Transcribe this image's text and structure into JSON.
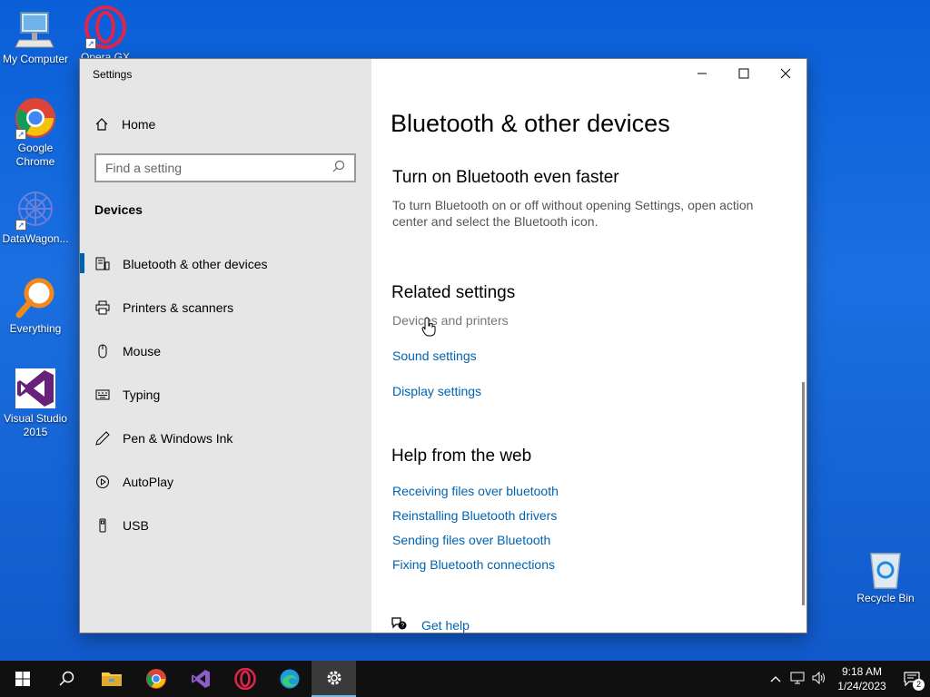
{
  "desktop": {
    "icons": [
      {
        "label": "My Computer"
      },
      {
        "label": "Opera GX"
      },
      {
        "label": "Google Chrome"
      },
      {
        "label": "DataWagon..."
      },
      {
        "label": "Everything"
      },
      {
        "label": "Visual Studio 2015"
      },
      {
        "label": "Recycle Bin"
      }
    ]
  },
  "window": {
    "title": "Settings",
    "sidebar": {
      "home_label": "Home",
      "search_placeholder": "Find a setting",
      "section_label": "Devices",
      "items": [
        {
          "label": "Bluetooth & other devices",
          "icon": "bluetooth-devices-icon",
          "active": true
        },
        {
          "label": "Printers & scanners",
          "icon": "printer-icon"
        },
        {
          "label": "Mouse",
          "icon": "mouse-icon"
        },
        {
          "label": "Typing",
          "icon": "keyboard-icon"
        },
        {
          "label": "Pen & Windows Ink",
          "icon": "pen-icon"
        },
        {
          "label": "AutoPlay",
          "icon": "autoplay-icon"
        },
        {
          "label": "USB",
          "icon": "usb-icon"
        }
      ]
    },
    "content": {
      "page_title": "Bluetooth & other devices",
      "faster_heading": "Turn on Bluetooth even faster",
      "faster_desc": "To turn Bluetooth on or off without opening Settings, open action center and select the Bluetooth icon.",
      "related_heading": "Related settings",
      "related_links": [
        "Devices and printers",
        "Sound settings",
        "Display settings"
      ],
      "help_heading": "Help from the web",
      "help_links": [
        "Receiving files over bluetooth",
        "Reinstalling Bluetooth drivers",
        "Sending files over Bluetooth",
        "Fixing Bluetooth connections"
      ],
      "get_help": "Get help"
    }
  },
  "taskbar": {
    "time": "9:18 AM",
    "date": "1/24/2023",
    "notification_count": "2"
  },
  "colors": {
    "accent": "#0063b1",
    "desktop": "#0a5fd8"
  }
}
